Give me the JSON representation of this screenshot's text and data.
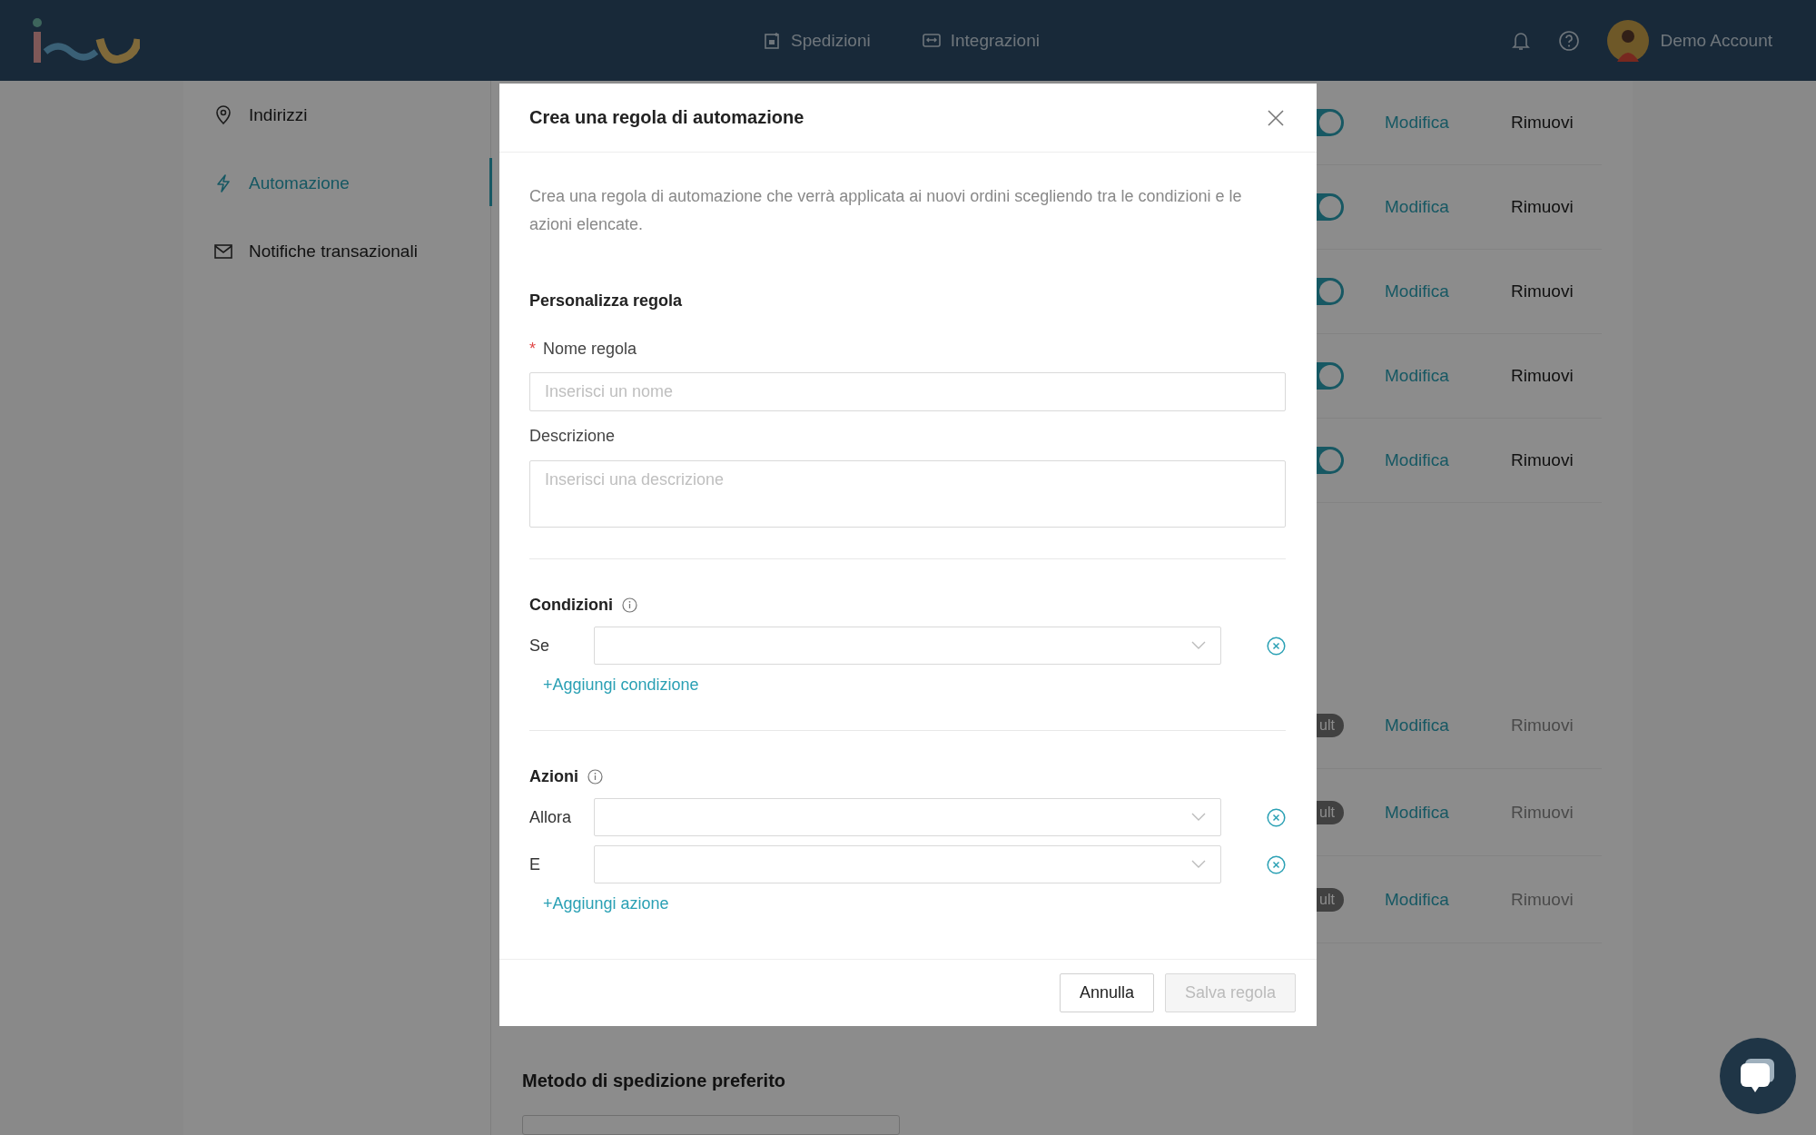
{
  "header": {
    "nav": [
      {
        "label": "Spedizioni"
      },
      {
        "label": "Integrazioni"
      }
    ],
    "account": {
      "name": "Demo Account"
    }
  },
  "sidebar": {
    "items": [
      {
        "label": "Indirizzi",
        "selected": false
      },
      {
        "label": "Automazione",
        "selected": true
      },
      {
        "label": "Notifiche transazionali",
        "selected": false
      }
    ]
  },
  "rules": [
    {
      "kind": "toggle",
      "on": true,
      "edit": "Modifica",
      "remove": "Rimuovi",
      "remove_disabled": false
    },
    {
      "kind": "toggle",
      "on": true,
      "edit": "Modifica",
      "remove": "Rimuovi",
      "remove_disabled": false
    },
    {
      "kind": "toggle",
      "on": true,
      "edit": "Modifica",
      "remove": "Rimuovi",
      "remove_disabled": false
    },
    {
      "kind": "toggle",
      "on": true,
      "edit": "Modifica",
      "remove": "Rimuovi",
      "remove_disabled": false
    },
    {
      "kind": "toggle",
      "on": true,
      "edit": "Modifica",
      "remove": "Rimuovi",
      "remove_disabled": false
    }
  ],
  "default_rules": [
    {
      "kind": "badge",
      "badge": "ult",
      "edit": "Modifica",
      "remove": "Rimuovi",
      "remove_disabled": true
    },
    {
      "kind": "badge",
      "badge": "ult",
      "edit": "Modifica",
      "remove": "Rimuovi",
      "remove_disabled": true
    },
    {
      "kind": "badge",
      "badge": "ult",
      "edit": "Modifica",
      "remove": "Rimuovi",
      "remove_disabled": true
    }
  ],
  "preferred_method": {
    "title": "Metodo di spedizione preferito"
  },
  "modal": {
    "title": "Crea una regola di automazione",
    "description": "Crea una regola di automazione che verrà applicata ai nuovi ordini scegliendo tra le condizioni e le azioni elencate.",
    "section_title": "Personalizza regola",
    "name_field": {
      "required_mark": "*",
      "label": "Nome regola",
      "placeholder": "Inserisci un nome"
    },
    "description_field": {
      "label": "Descrizione",
      "placeholder": "Inserisci una descrizione"
    },
    "conditions": {
      "title": "Condizioni",
      "rows": [
        {
          "label": "Se"
        }
      ],
      "add": "+Aggiungi condizione"
    },
    "actions": {
      "title": "Azioni",
      "rows": [
        {
          "label": "Allora"
        },
        {
          "label": "E"
        }
      ],
      "add": "+Aggiungi azione"
    },
    "buttons": [
      {
        "label": "Annulla",
        "disabled": false
      },
      {
        "label": "Salva regola",
        "disabled": true
      }
    ]
  }
}
